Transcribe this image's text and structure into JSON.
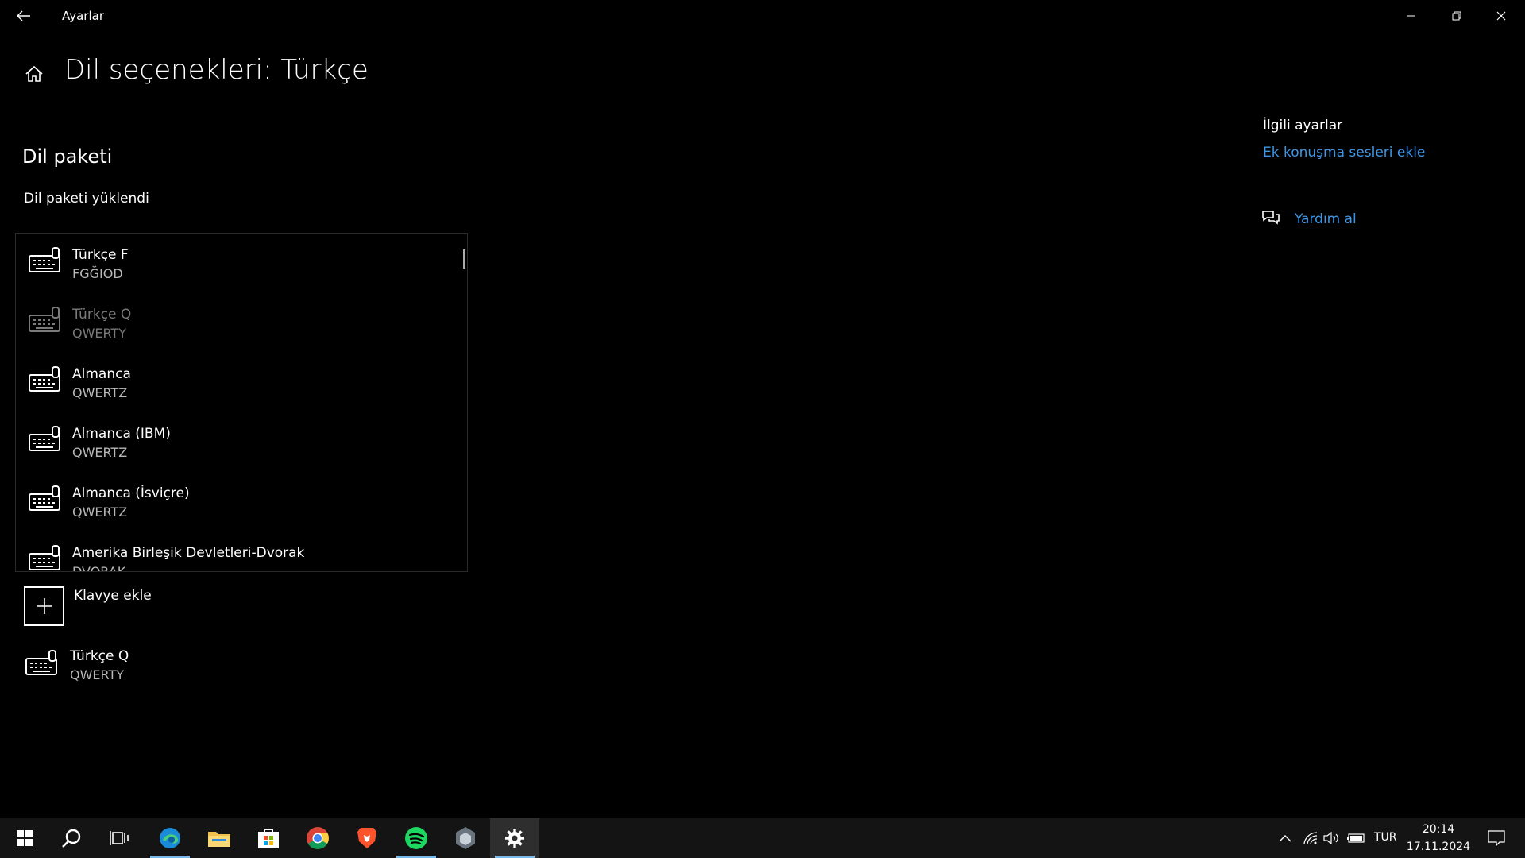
{
  "window": {
    "title": "Ayarlar"
  },
  "header": {
    "title": "Dil seçenekleri: Türkçe"
  },
  "language_pack": {
    "section_title": "Dil paketi",
    "status": "Dil paketi yüklendi"
  },
  "keyboards": [
    {
      "name": "Türkçe F",
      "layout": "FGĞIOD",
      "dimmed": false
    },
    {
      "name": "Türkçe Q",
      "layout": "QWERTY",
      "dimmed": true
    },
    {
      "name": "Almanca",
      "layout": "QWERTZ",
      "dimmed": false
    },
    {
      "name": "Almanca (IBM)",
      "layout": "QWERTZ",
      "dimmed": false
    },
    {
      "name": "Almanca (İsviçre)",
      "layout": "QWERTZ",
      "dimmed": false
    },
    {
      "name": "Amerika Birleşik Devletleri-Dvorak",
      "layout": "DVORAK",
      "dimmed": false
    }
  ],
  "add_keyboard": {
    "label": "Klavye ekle"
  },
  "installed_keyboard": {
    "name": "Türkçe Q",
    "layout": "QWERTY"
  },
  "related": {
    "title": "İlgili ayarlar",
    "link": "Ek konuşma sesleri ekle"
  },
  "help": {
    "label": "Yardım al"
  },
  "taskbar": {
    "apps": [
      "start-icon",
      "search-icon",
      "task-view-icon",
      "edge-icon",
      "file-explorer-icon",
      "store-icon",
      "chrome-icon",
      "brave-icon",
      "spotify-icon",
      "app-icon",
      "settings-icon"
    ],
    "language": "TUR",
    "time": "20:14",
    "date": "17.11.2024"
  },
  "colors": {
    "link": "#3d96e6",
    "background": "#000000",
    "taskbar": "#141414",
    "accent": "#76b9ed"
  }
}
